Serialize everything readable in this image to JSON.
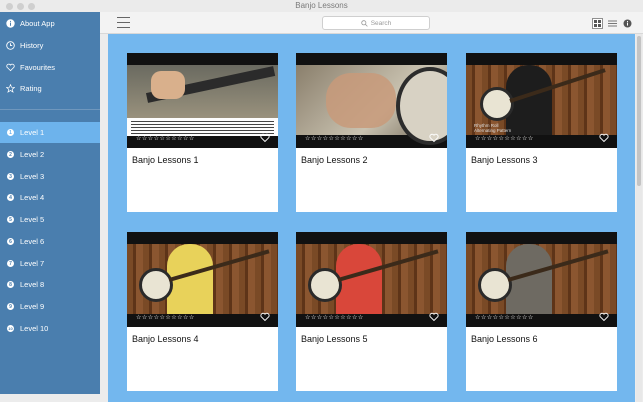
{
  "window": {
    "title": "Banjo Lessons"
  },
  "sidebar": {
    "items": [
      {
        "label": "About App",
        "icon": "info-icon"
      },
      {
        "label": "History",
        "icon": "clock-icon"
      },
      {
        "label": "Favourites",
        "icon": "heart-outline-icon"
      },
      {
        "label": "Rating",
        "icon": "star-outline-icon"
      }
    ],
    "levels": [
      {
        "label": "Level 1",
        "num": "1",
        "selected": true
      },
      {
        "label": "Level 2",
        "num": "2"
      },
      {
        "label": "Level 3",
        "num": "3"
      },
      {
        "label": "Level 4",
        "num": "4"
      },
      {
        "label": "Level 5",
        "num": "5"
      },
      {
        "label": "Level 6",
        "num": "6"
      },
      {
        "label": "Level 7",
        "num": "7"
      },
      {
        "label": "Level 8",
        "num": "8"
      },
      {
        "label": "Level 9",
        "num": "9"
      },
      {
        "label": "Level 10",
        "num": "10"
      }
    ]
  },
  "toolbar": {
    "search_placeholder": "Search",
    "view_buttons": [
      "grid-view-icon",
      "list-view-icon",
      "info-icon"
    ]
  },
  "cards": [
    {
      "title": "Banjo Lessons 1",
      "rating": "☆☆☆☆☆☆☆☆☆☆",
      "thumb": "closeup-tab"
    },
    {
      "title": "Banjo Lessons 2",
      "rating": "☆☆☆☆☆☆☆☆☆☆",
      "thumb": "closeup-hand"
    },
    {
      "title": "Banjo Lessons 3",
      "rating": "☆☆☆☆☆☆☆☆☆☆",
      "thumb": "player-black",
      "caption_line1": "Rhythm Roll",
      "caption_line2": "Alternating Pattern"
    },
    {
      "title": "Banjo Lessons 4",
      "rating": "☆☆☆☆☆☆☆☆☆☆",
      "thumb": "player-yellow"
    },
    {
      "title": "Banjo Lessons 5",
      "rating": "☆☆☆☆☆☆☆☆☆☆",
      "thumb": "player-red"
    },
    {
      "title": "Banjo Lessons 6",
      "rating": "☆☆☆☆☆☆☆☆☆☆",
      "thumb": "player-grey"
    }
  ],
  "colors": {
    "sidebar_bg": "#4a7eae",
    "sidebar_selected": "#6db3ec",
    "content_bg": "#73b7ee"
  }
}
